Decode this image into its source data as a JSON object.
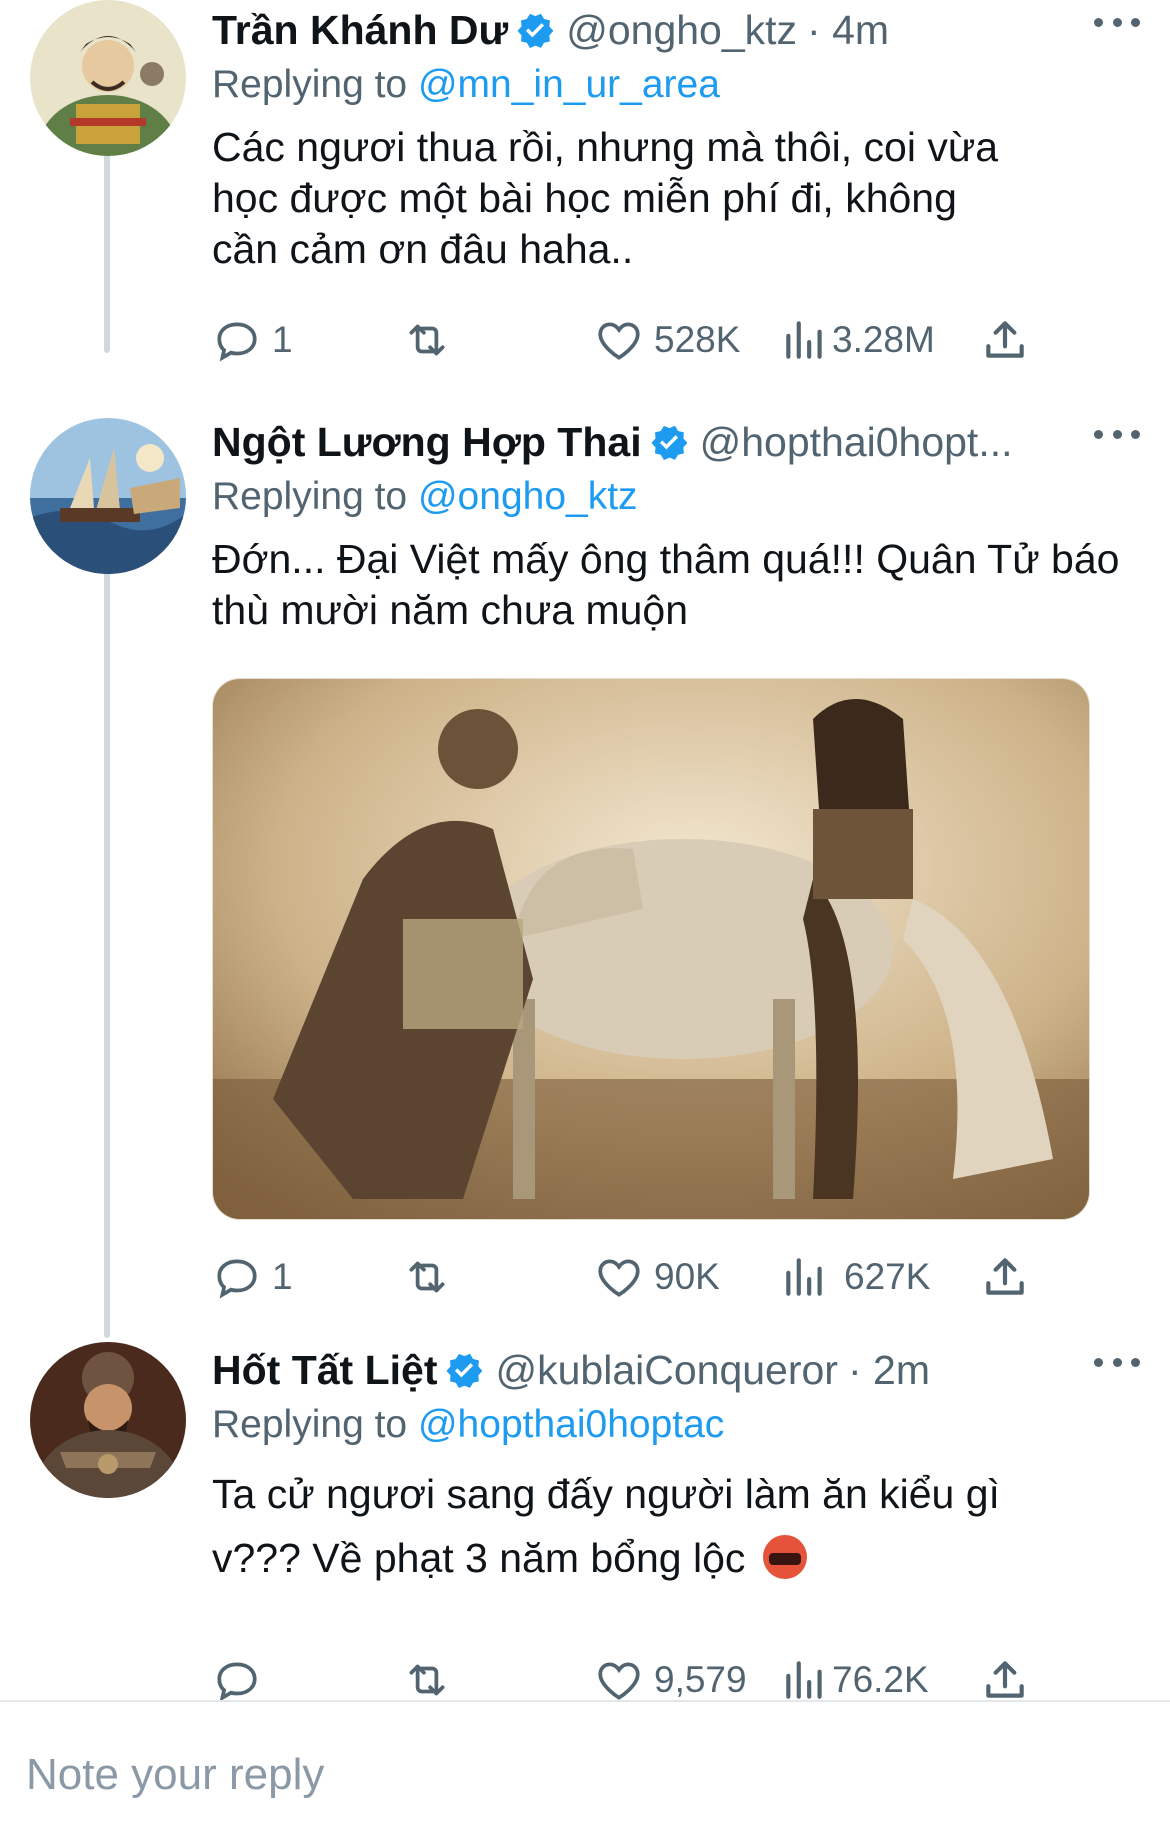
{
  "tweets": [
    {
      "name": "Trần Khánh Dư",
      "handle": "@ongho_ktz",
      "time": "· 4m",
      "replying_prefix": "Replying to",
      "replying_to": "@mn_in_ur_area",
      "text": "Các ngươi thua rồi, nhưng mà thôi, coi vừa học được một bài học miễn phí đi, không cần cảm ơn đâu haha..",
      "replies": "1",
      "retweets": "",
      "likes": "528K",
      "views": "3.28M"
    },
    {
      "name": "Ngột Lương Hợp Thai",
      "handle": "@hopthai0hopt...",
      "time": "",
      "replying_prefix": "Replying to",
      "replying_to": "@ongho_ktz",
      "text": "Đớn... Đại Việt mấy ông thâm quá!!! Quân Tử báo thù mười năm chưa muộn",
      "replies": "1",
      "retweets": "",
      "likes": "90K",
      "views": "627K"
    },
    {
      "name": "Hốt Tất Liệt",
      "handle": "@kublaiConqueror",
      "time": "· 2m",
      "replying_prefix": "Replying to",
      "replying_to": "@hopthai0hoptac",
      "text": "Ta cử ngươi sang đấy người làm ăn kiểu gì v??? Về phạt 3 năm bổng lộc",
      "replies": "",
      "retweets": "",
      "likes": "9,579",
      "views": "76.2K"
    }
  ],
  "reply_box": {
    "placeholder": "Note your reply"
  },
  "icons": {
    "verified": "verified-badge-icon",
    "reply": "reply-bubble-icon",
    "retweet": "retweet-icon",
    "like": "heart-icon",
    "views": "views-bar-chart-icon",
    "share": "share-upload-icon",
    "more": "more-dots-icon",
    "emoji": "angry-cursing-face-emoji"
  },
  "colors": {
    "accent": "#1d9bf0",
    "secondary_text": "#536471",
    "primary_text": "#0f1419"
  }
}
